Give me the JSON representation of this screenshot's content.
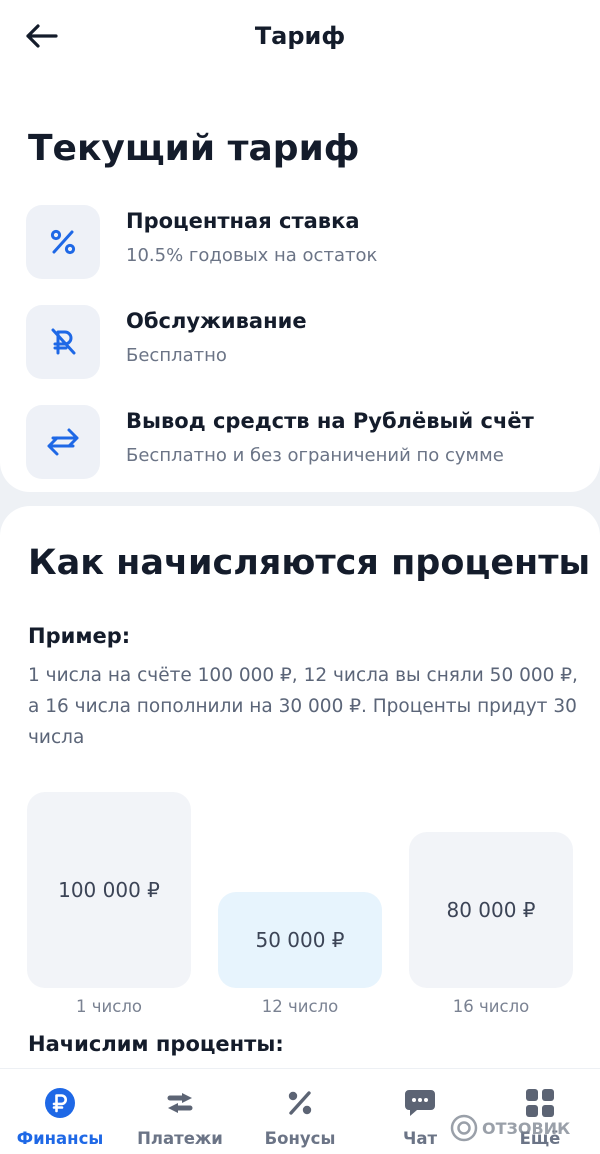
{
  "header": {
    "title": "Тариф",
    "back_icon": "arrow-left-icon"
  },
  "current_tariff": {
    "title": "Текущий тариф",
    "items": [
      {
        "icon": "percent-icon",
        "title": "Процентная ставка",
        "subtitle": "10.5% годовых на остаток"
      },
      {
        "icon": "ruble-crossed-icon",
        "title": "Обслуживание",
        "subtitle": "Бесплатно"
      },
      {
        "icon": "transfer-arrows-icon",
        "title": "Вывод средств на Рублёвый счёт",
        "subtitle": "Бесплатно и без ограничений по сумме"
      }
    ]
  },
  "interest": {
    "title": "Как начисляются проценты",
    "example_label": "Пример:",
    "example_text": "1 числа на счёте 100 000 ₽, 12 числа вы сняли 50 000 ₽, а 16 числа пополнили на 30 000 ₽. Проценты придут 30 числа",
    "bars": [
      {
        "amount": "100 000 ₽",
        "label": "1 число",
        "value": 100000,
        "color": "#f2f4f8"
      },
      {
        "amount": "50 000 ₽",
        "label": "12 число",
        "value": 50000,
        "color": "#e7f4fd"
      },
      {
        "amount": "80 000 ₽",
        "label": "16 число",
        "value": 80000,
        "color": "#f2f4f8"
      }
    ],
    "accrue_label": "Начислим проценты:"
  },
  "tabs": [
    {
      "label": "Финансы",
      "icon": "ruble-circle-icon",
      "active": true
    },
    {
      "label": "Платежи",
      "icon": "exchange-arrows-icon",
      "active": false
    },
    {
      "label": "Бонусы",
      "icon": "percent-icon",
      "active": false
    },
    {
      "label": "Чат",
      "icon": "chat-bubble-icon",
      "active": false
    },
    {
      "label": "Ещё",
      "icon": "grid-icon",
      "active": false
    }
  ],
  "watermark": "ОТЗОВИК",
  "colors": {
    "accent": "#1e68e6",
    "text": "#141c2b",
    "muted": "#6b7486",
    "icon_gray": "#5c6474"
  }
}
